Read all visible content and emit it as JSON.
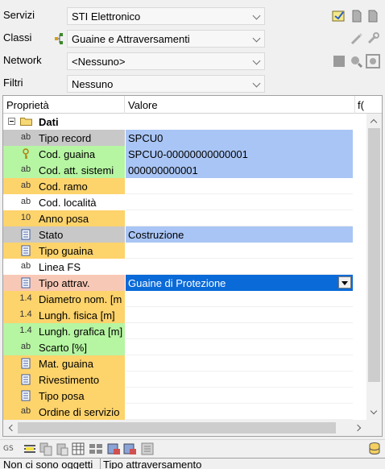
{
  "selectors": {
    "servizi": {
      "label": "Servizi",
      "value": "STI Elettronico"
    },
    "classi": {
      "label": "Classi",
      "value": "Guaine e Attraversamenti"
    },
    "network": {
      "label": "Network",
      "value": "<Nessuno>"
    },
    "filtri": {
      "label": "Filtri",
      "value": "Nessuno"
    }
  },
  "grid": {
    "headers": {
      "property": "Proprietà",
      "value": "Valore",
      "extra": "f("
    },
    "category": "Dati",
    "rows": [
      {
        "type_icon": "ab",
        "name": "Tipo record",
        "value": "SPCU0",
        "name_color": "#c8c8c8",
        "value_style": "blue"
      },
      {
        "type_icon": "key-icon",
        "name": "Cod. guaina",
        "value": "SPCU0-00000000000001",
        "name_color": "#b6f5a2",
        "value_style": "blue"
      },
      {
        "type_icon": "ab",
        "name": "Cod. att. sistemi",
        "value": "000000000001",
        "name_color": "#b6f5a2",
        "value_style": "blue"
      },
      {
        "type_icon": "ab",
        "name": "Cod. ramo",
        "value": "",
        "name_color": "#fdd36c",
        "value_style": "white"
      },
      {
        "type_icon": "ab",
        "name": "Cod. località",
        "value": "",
        "name_color": "#ffffff",
        "value_style": "white"
      },
      {
        "type_icon": "10",
        "name": "Anno posa",
        "value": "",
        "name_color": "#fdd36c",
        "value_style": "white"
      },
      {
        "type_icon": "list-icon",
        "name": "Stato",
        "value": "Costruzione",
        "name_color": "#c8c8c8",
        "value_style": "blue"
      },
      {
        "type_icon": "list-icon",
        "name": "Tipo guaina",
        "value": "",
        "name_color": "#fdd36c",
        "value_style": "white"
      },
      {
        "type_icon": "ab",
        "name": "Linea FS",
        "value": "",
        "name_color": "#ffffff",
        "value_style": "white"
      },
      {
        "type_icon": "list-icon",
        "name": "Tipo attrav.",
        "value": "Guaine di Protezione",
        "name_color": "#f8c8b6",
        "value_style": "selected"
      },
      {
        "type_icon": "1.4",
        "name": "Diametro nom. [m",
        "value": "",
        "name_color": "#fdd36c",
        "value_style": "white"
      },
      {
        "type_icon": "1.4",
        "name": "Lungh. fisica [m]",
        "value": "",
        "name_color": "#fdd36c",
        "value_style": "white"
      },
      {
        "type_icon": "1.4",
        "name": "Lungh. grafica [m]",
        "value": "",
        "name_color": "#b6f5a2",
        "value_style": "white"
      },
      {
        "type_icon": "ab",
        "name": "Scarto [%]",
        "value": "",
        "name_color": "#b6f5a2",
        "value_style": "white"
      },
      {
        "type_icon": "list-icon",
        "name": "Mat. guaina",
        "value": "",
        "name_color": "#fdd36c",
        "value_style": "white"
      },
      {
        "type_icon": "list-icon",
        "name": "Rivestimento",
        "value": "",
        "name_color": "#fdd36c",
        "value_style": "white"
      },
      {
        "type_icon": "list-icon",
        "name": "Tipo posa",
        "value": "",
        "name_color": "#fdd36c",
        "value_style": "white"
      },
      {
        "type_icon": "ab",
        "name": "Ordine di servizio",
        "value": "",
        "name_color": "#fdd36c",
        "value_style": "white"
      }
    ]
  },
  "toolbar": {
    "gs_label": "GS"
  },
  "status": {
    "left": "Non ci sono oggetti",
    "right": "Tipo attraversamento"
  }
}
